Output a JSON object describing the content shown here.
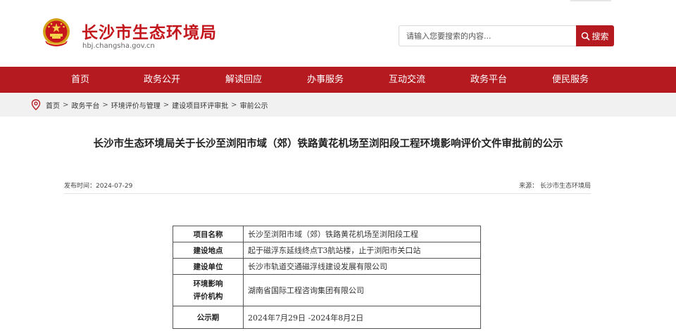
{
  "header": {
    "site_name": "长沙市生态环境局",
    "site_domain": "hbj.changsha.gov.cn",
    "search_placeholder": "请输入您要搜索的内容...",
    "search_button": "搜索",
    "emblem_icon": "national-emblem-icon"
  },
  "nav": {
    "items": [
      "首页",
      "政务公开",
      "解读回应",
      "办事服务",
      "互动交流",
      "政务平台",
      "便民服务"
    ]
  },
  "breadcrumb": {
    "items": [
      "首页",
      "政务平台",
      "环境评价与管理",
      "建设项目环评审批",
      "审前公示"
    ],
    "separator": ">"
  },
  "article": {
    "title": "长沙市生态环境局关于长沙至浏阳市域（郊）铁路黄花机场至浏阳段工程环境影响评价文件审批前的公示",
    "publish_time": "发布时间：2024-07-29",
    "source": "来源：  长沙市生态环境局"
  },
  "table": {
    "rows": [
      {
        "key": "项目名称",
        "value": "长沙至浏阳市域（郊）铁路黄花机场至浏阳段工程"
      },
      {
        "key": "建设地点",
        "value": "起于磁浮东延线终点T3航站楼，止于浏阳市关口站"
      },
      {
        "key": "建设单位",
        "value": "长沙市轨道交通磁浮线建设发展有限公司"
      },
      {
        "key_line1": "环境影响",
        "key_line2": "评价机构",
        "value": "湖南省国际工程咨询集团有限公司"
      },
      {
        "key": "公示期",
        "value": "2024年7月29日 -2024年8月2日"
      }
    ]
  },
  "colors": {
    "brand_red": "#b51a21",
    "title_red": "#c3161c",
    "crumb_bg": "#f1f1f1"
  }
}
